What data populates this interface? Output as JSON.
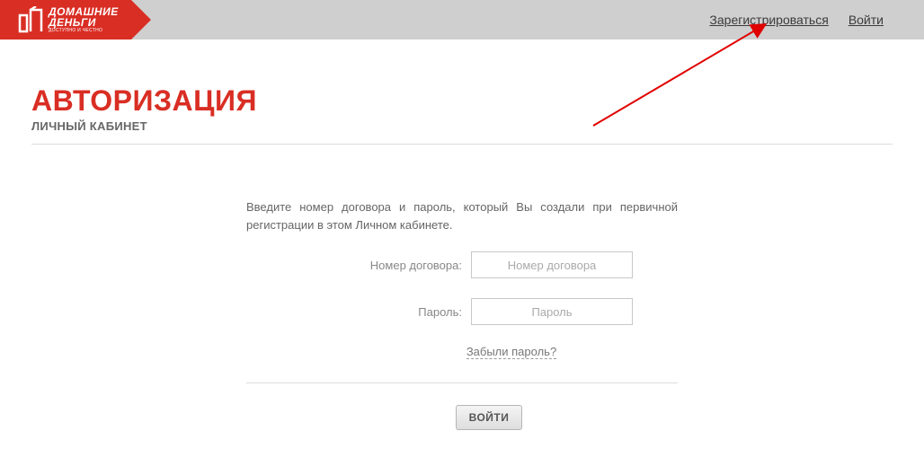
{
  "header": {
    "logo": {
      "line1": "ДОМАШНИЕ",
      "line2": "ДЕНЬГИ",
      "tagline": "ДОСТУПНО И ЧЕСТНО"
    },
    "nav": {
      "register": "Зарегистрироваться",
      "login": "Войти"
    }
  },
  "page": {
    "title": "АВТОРИЗАЦИЯ",
    "subtitle": "ЛИЧНЫЙ КАБИНЕТ"
  },
  "form": {
    "instruction": "Введите номер договора и пароль, который Вы создали при первичной регистрации в этом Личном кабинете.",
    "contract_label": "Номер договора:",
    "contract_placeholder": "Номер договора",
    "password_label": "Пароль:",
    "password_placeholder": "Пароль",
    "forgot": "Забыли пароль?",
    "submit": "ВОЙТИ"
  },
  "colors": {
    "brand_red": "#d92e24",
    "header_grey": "#cfcfcf"
  }
}
